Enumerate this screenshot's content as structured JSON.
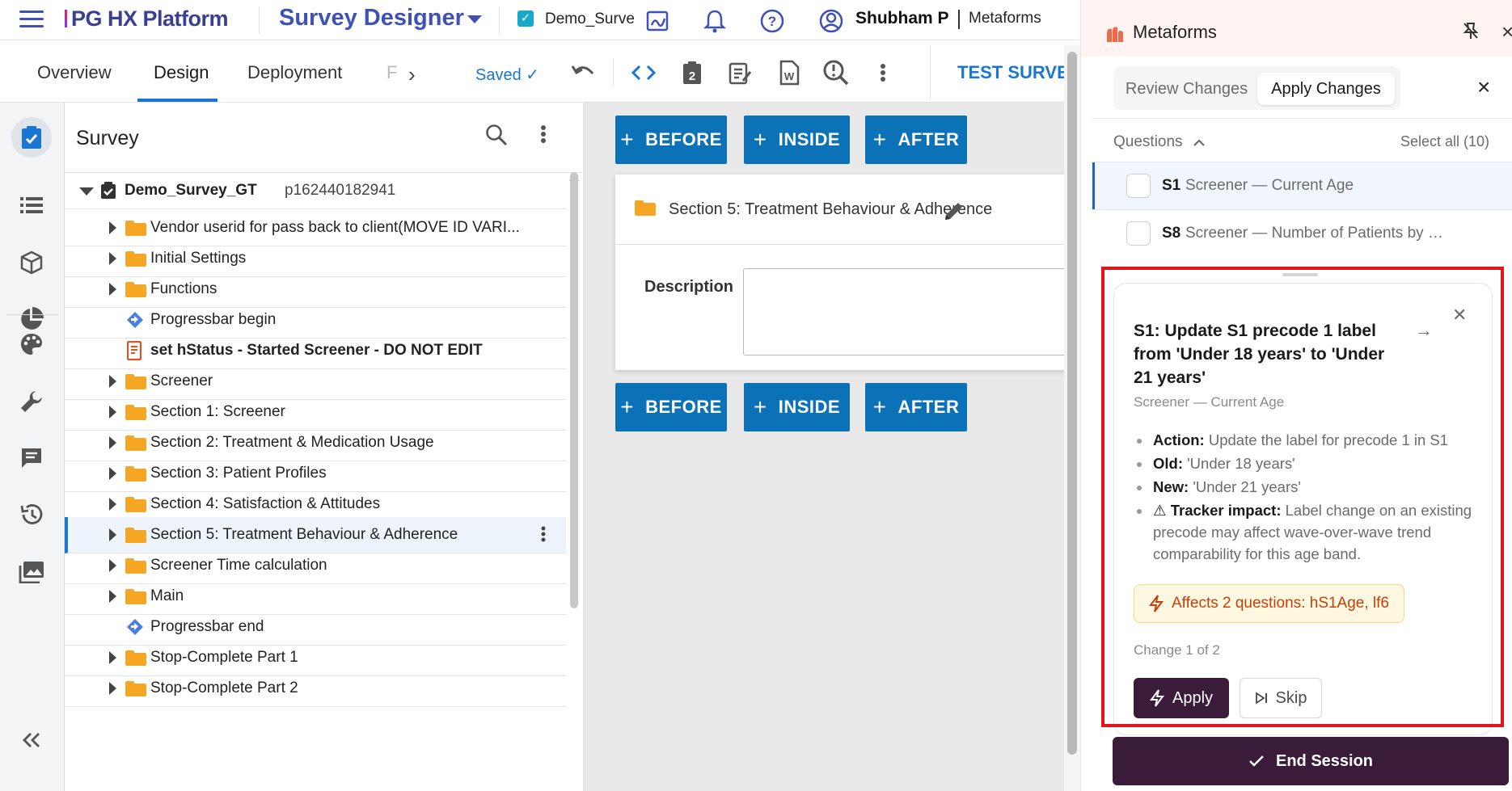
{
  "app": {
    "brand": "PG HX Platform",
    "module": "Survey Designer",
    "project": "Demo_Surve",
    "user": "Shubham P",
    "org": "Metaforms"
  },
  "tabs": {
    "overview": "Overview",
    "design": "Design",
    "deployment": "Deployment",
    "truncated": "F",
    "saved": "Saved",
    "test_survey": "TEST SURVEY"
  },
  "tree": {
    "header": "Survey",
    "root": {
      "name": "Demo_Survey_GT",
      "id": "p162440182941"
    },
    "items": [
      {
        "label": "Vendor userid for pass back to client(MOVE ID VARI...",
        "type": "folder"
      },
      {
        "label": "Initial Settings",
        "type": "folder"
      },
      {
        "label": "Functions",
        "type": "folder"
      },
      {
        "label": "Progressbar begin",
        "type": "progress"
      },
      {
        "label": "set hStatus - Started Screener - DO NOT EDIT",
        "type": "script"
      },
      {
        "label": "Screener",
        "type": "folder"
      },
      {
        "label": "Section 1: Screener",
        "type": "folder"
      },
      {
        "label": "Section 2: Treatment & Medication Usage",
        "type": "folder"
      },
      {
        "label": "Section 3: Patient Profiles",
        "type": "folder"
      },
      {
        "label": "Section 4: Satisfaction & Attitudes",
        "type": "folder"
      },
      {
        "label": "Section 5: Treatment Behaviour & Adherence",
        "type": "folder",
        "selected": true
      },
      {
        "label": "Screener Time calculation",
        "type": "folder"
      },
      {
        "label": "Main",
        "type": "folder"
      },
      {
        "label": "Progressbar end",
        "type": "progress"
      },
      {
        "label": "Stop-Complete Part 1",
        "type": "folder"
      },
      {
        "label": "Stop-Complete Part 2",
        "type": "folder"
      }
    ]
  },
  "canvas": {
    "btn_before": "BEFORE",
    "btn_inside": "INSIDE",
    "btn_after": "AFTER",
    "section_title": "Section 5: Treatment Behaviour & Adherence",
    "description_label": "Description"
  },
  "metaforms": {
    "title": "Metaforms",
    "tab_review": "Review Changes",
    "tab_apply": "Apply Changes",
    "questions_label": "Questions",
    "select_all": "Select all (10)",
    "questions": [
      {
        "code": "S1",
        "text": "Screener — Current Age"
      },
      {
        "code": "S8",
        "text": "Screener — Number of Patients by Conditi..."
      }
    ],
    "change": {
      "title": "S1: Update S1 precode 1 label from 'Under 18 years' to 'Under 21 years'",
      "subtitle": "Screener — Current Age",
      "action_label": "Action:",
      "action_value": "Update the label for precode 1 in S1",
      "old_label": "Old:",
      "old_value": "'Under 18 years'",
      "new_label": "New:",
      "new_value": "'Under 21 years'",
      "tracker_label": "Tracker impact:",
      "tracker_value": "Label change on an existing precode may affect wave-over-wave trend comparability for this age band.",
      "affects": "Affects 2 questions: hS1Age, lf6",
      "counter": "Change 1 of 2",
      "apply": "Apply",
      "skip": "Skip"
    },
    "end_session": "End Session"
  },
  "colors": {
    "primary": "#1976d2",
    "canvas_button": "#0b72b8",
    "folder": "#f5a623",
    "dark_button": "#3b1b3a",
    "highlight": "#e0161c",
    "accent_orange": "#c2410c"
  }
}
